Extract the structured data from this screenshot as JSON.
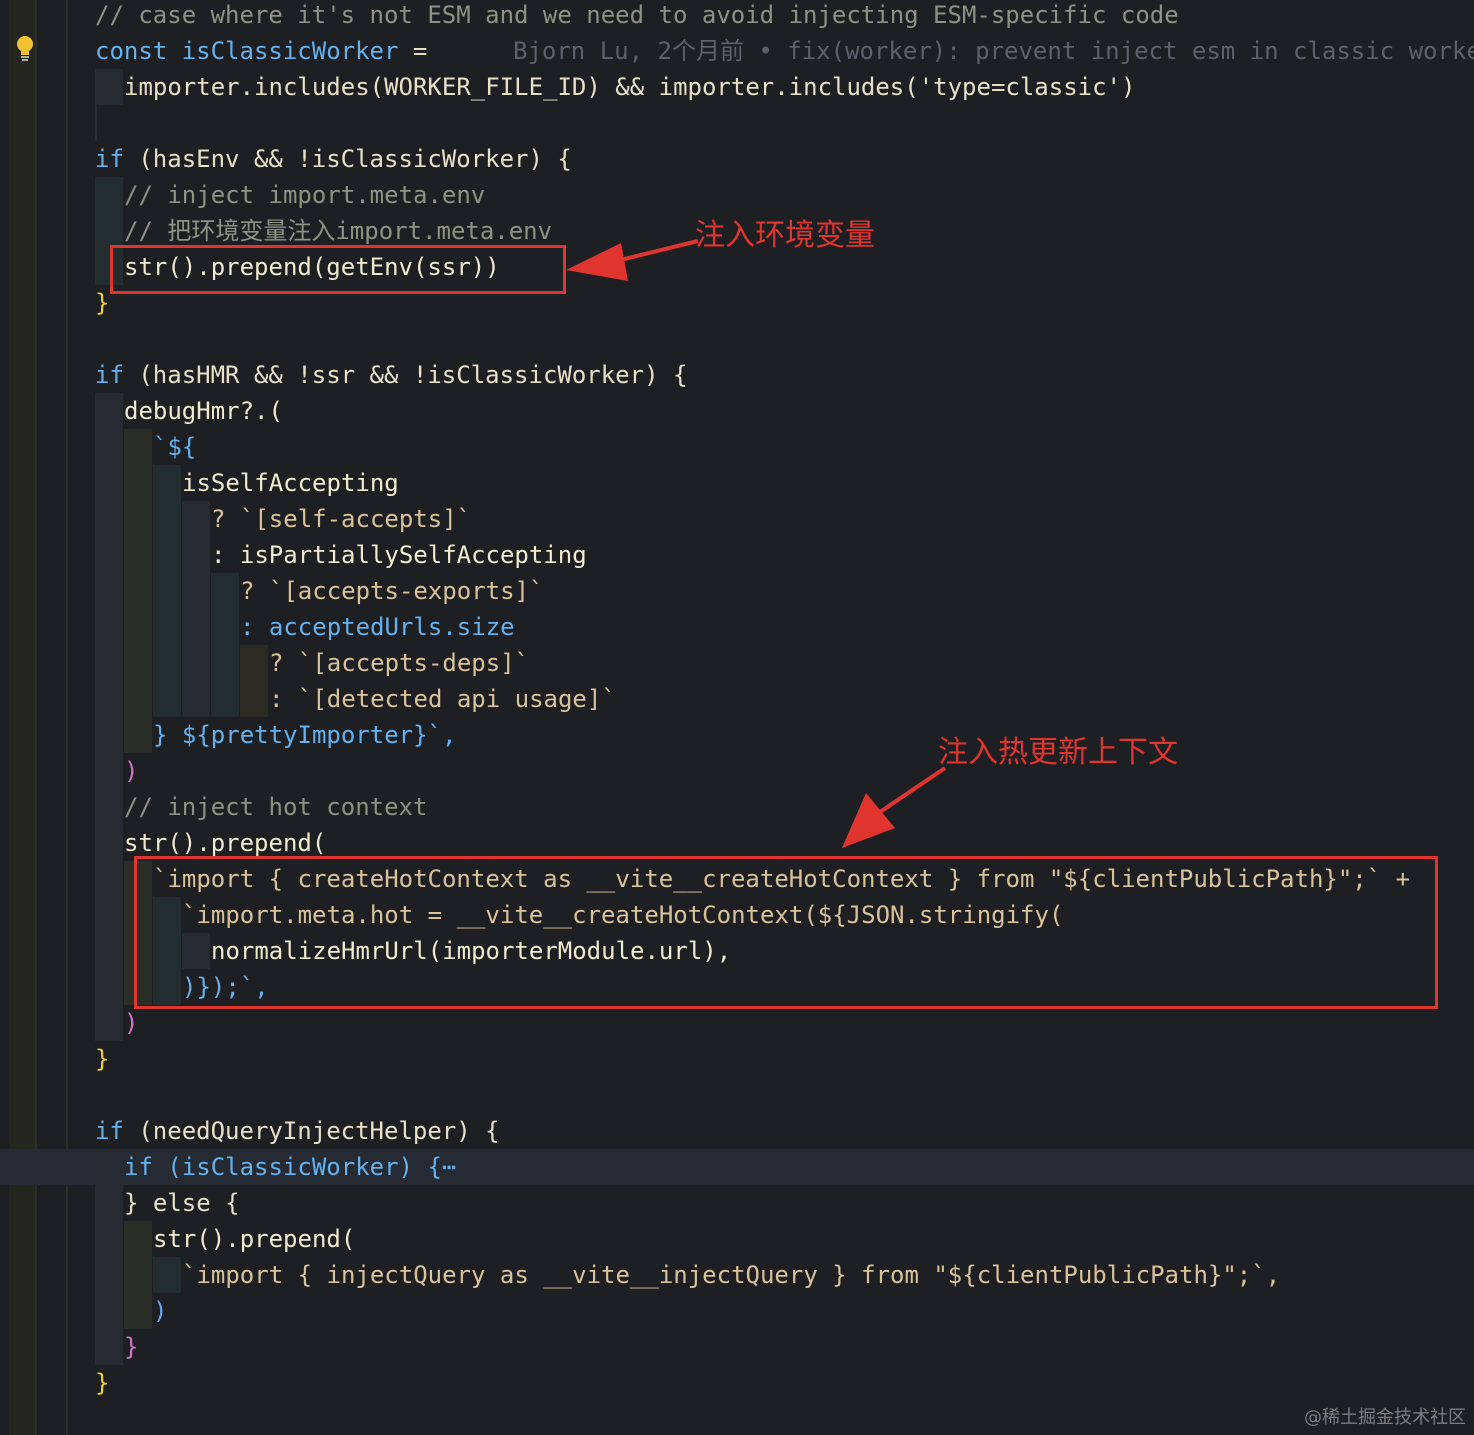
{
  "editor": {
    "lines": [
      {
        "c1": "// case where it's not ESM and we need to avoid injecting ESM-specific code"
      },
      {
        "kw": "const",
        "name": "isClassicWorker",
        "op": "=",
        "blame": "Bjorn Lu, 2个月前 • fix(worker): prevent inject esm in classic worke"
      },
      {
        "t1": "importer.includes(WORKER_FILE_ID) && importer.includes('type=classic')"
      },
      {
        "kw": "if",
        "cond": "(hasEnv && !isClassicWorker) {"
      },
      {
        "c1": "// inject import.meta.env"
      },
      {
        "c1": "// 把环境变量注入import.meta.env"
      },
      {
        "t1": "str().prepend(getEnv(ssr))"
      },
      {
        "t1": "}"
      },
      {
        "kw": "if",
        "cond": "(hasHMR && !ssr && !isClassicWorker) {"
      },
      {
        "t1": "debugHmr?.("
      },
      {
        "t1": "`${"
      },
      {
        "t1": "isSelfAccepting"
      },
      {
        "t1": "? `[self-accepts]`"
      },
      {
        "t1": ": isPartiallySelfAccepting"
      },
      {
        "t1": "? `[accepts-exports]`"
      },
      {
        "t1": ": acceptedUrls.size"
      },
      {
        "t1": "? `[accepts-deps]`"
      },
      {
        "t1": ": `[detected api usage]`"
      },
      {
        "t1": "} ${prettyImporter}`,"
      },
      {
        "t1": ")"
      },
      {
        "c1": "// inject hot context"
      },
      {
        "t1": "str().prepend("
      },
      {
        "t1": "`import { createHotContext as __vite__createHotContext } from \"${clientPublicPath}\";` +"
      },
      {
        "t1": "`import.meta.hot = __vite__createHotContext(${JSON.stringify("
      },
      {
        "t1": "normalizeHmrUrl(importerModule.url),"
      },
      {
        "t1": ")});`,"
      },
      {
        "t1": ")"
      },
      {
        "t1": "}"
      },
      {
        "kw": "if",
        "cond": "(needQueryInjectHelper) {"
      },
      {
        "kw": "if",
        "cond": "(isClassicWorker) {⋯"
      },
      {
        "t1": "} else {"
      },
      {
        "t1": "str().prepend("
      },
      {
        "t1": "`import { injectQuery as __vite__injectQuery } from \"${clientPublicPath}\";`,"
      },
      {
        "t1": ")"
      },
      {
        "t1": "}"
      },
      {
        "t1": "}"
      }
    ]
  },
  "annotations": {
    "env_label": "注入环境变量",
    "hmr_label": "注入热更新上下文"
  },
  "colors": {
    "annotation": "#e0342e",
    "keyword": "#63b1ee",
    "comment": "#8c9384",
    "string": "#d8c29a",
    "bracket": "#f2cc3e"
  },
  "icons": {
    "gutter": "lightbulb-icon"
  },
  "watermark": "@稀土掘金技术社区"
}
